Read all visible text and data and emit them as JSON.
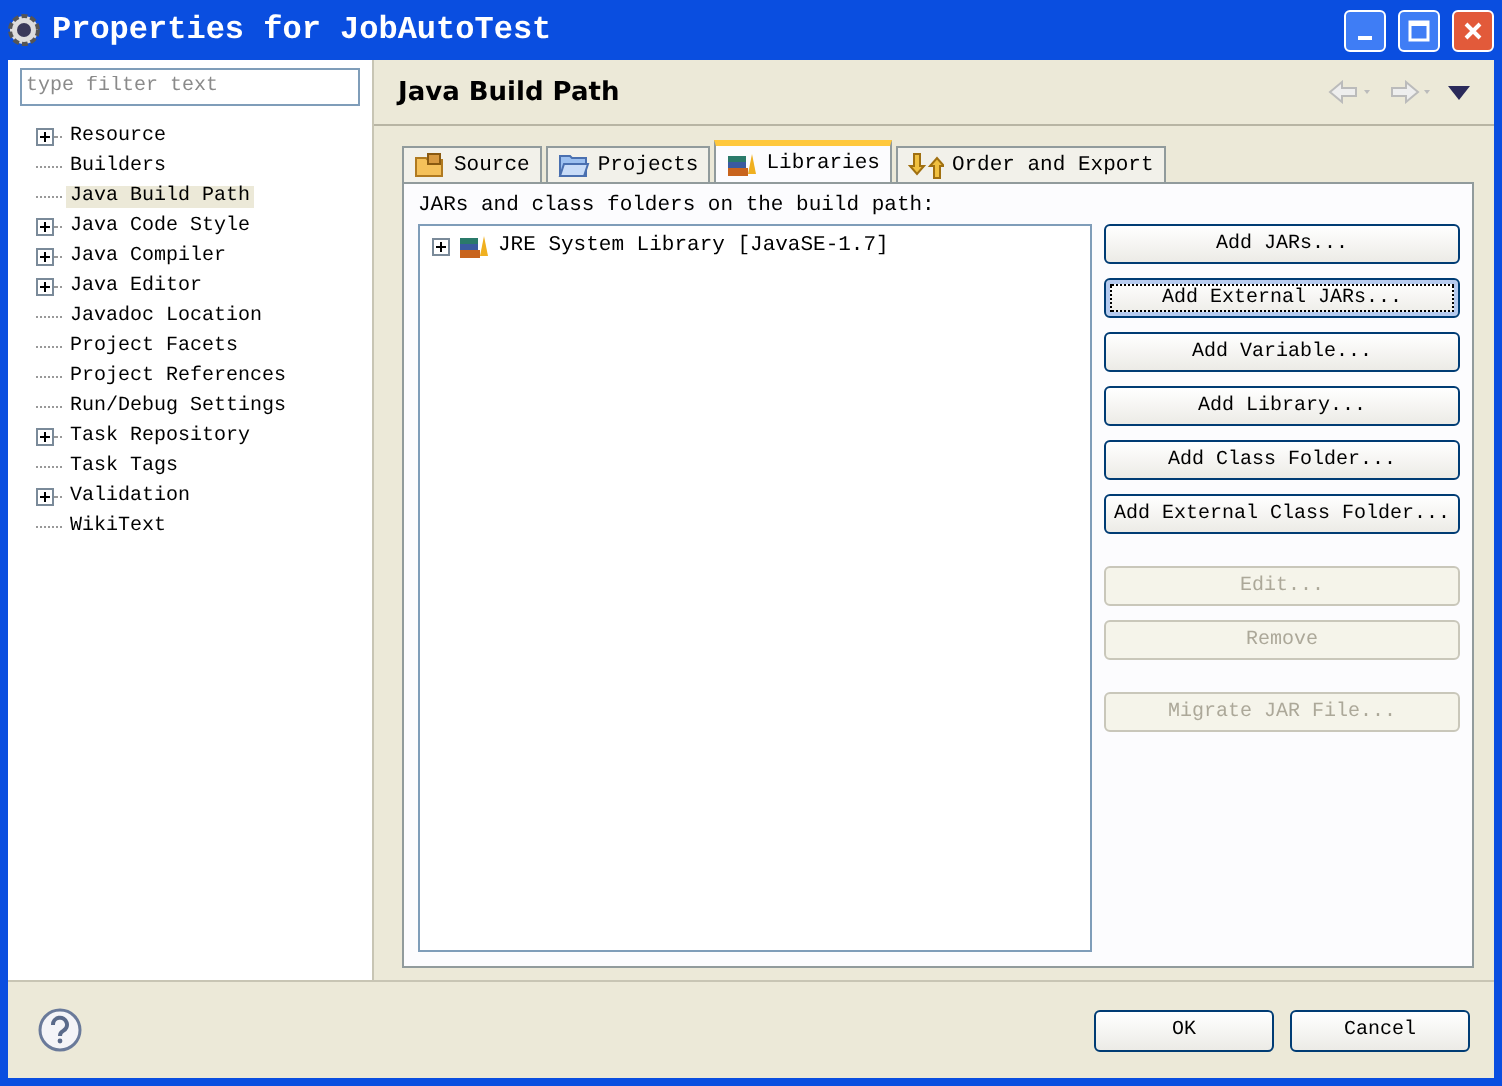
{
  "window": {
    "title": "Properties for JobAutoTest"
  },
  "filter": {
    "placeholder": "type filter text"
  },
  "tree": [
    {
      "label": "Resource",
      "has_children": true,
      "selected": false
    },
    {
      "label": "Builders",
      "has_children": false,
      "selected": false
    },
    {
      "label": "Java Build Path",
      "has_children": false,
      "selected": true
    },
    {
      "label": "Java Code Style",
      "has_children": true,
      "selected": false
    },
    {
      "label": "Java Compiler",
      "has_children": true,
      "selected": false
    },
    {
      "label": "Java Editor",
      "has_children": true,
      "selected": false
    },
    {
      "label": "Javadoc Location",
      "has_children": false,
      "selected": false
    },
    {
      "label": "Project Facets",
      "has_children": false,
      "selected": false
    },
    {
      "label": "Project References",
      "has_children": false,
      "selected": false
    },
    {
      "label": "Run/Debug Settings",
      "has_children": false,
      "selected": false
    },
    {
      "label": "Task Repository",
      "has_children": true,
      "selected": false
    },
    {
      "label": "Task Tags",
      "has_children": false,
      "selected": false
    },
    {
      "label": "Validation",
      "has_children": true,
      "selected": false
    },
    {
      "label": "WikiText",
      "has_children": false,
      "selected": false
    }
  ],
  "page": {
    "title": "Java Build Path"
  },
  "tabs": [
    {
      "label": "Source",
      "selected": false
    },
    {
      "label": "Projects",
      "selected": false
    },
    {
      "label": "Libraries",
      "selected": true
    },
    {
      "label": "Order and Export",
      "selected": false
    }
  ],
  "libraries": {
    "label": "JARs and class folders on the build path:",
    "entries": [
      {
        "label": "JRE System Library [JavaSE-1.7]",
        "expanded": false
      }
    ]
  },
  "button_groups": [
    [
      {
        "label": "Add JARs...",
        "disabled": false,
        "focused": false
      },
      {
        "label": "Add External JARs...",
        "disabled": false,
        "focused": true
      },
      {
        "label": "Add Variable...",
        "disabled": false,
        "focused": false
      },
      {
        "label": "Add Library...",
        "disabled": false,
        "focused": false
      },
      {
        "label": "Add Class Folder...",
        "disabled": false,
        "focused": false
      },
      {
        "label": "Add External Class Folder...",
        "disabled": false,
        "focused": false
      }
    ],
    [
      {
        "label": "Edit...",
        "disabled": true,
        "focused": false
      },
      {
        "label": "Remove",
        "disabled": true,
        "focused": false
      }
    ],
    [
      {
        "label": "Migrate JAR File...",
        "disabled": true,
        "focused": false
      }
    ]
  ],
  "dialog_buttons": [
    {
      "label": "OK"
    },
    {
      "label": "Cancel"
    }
  ]
}
